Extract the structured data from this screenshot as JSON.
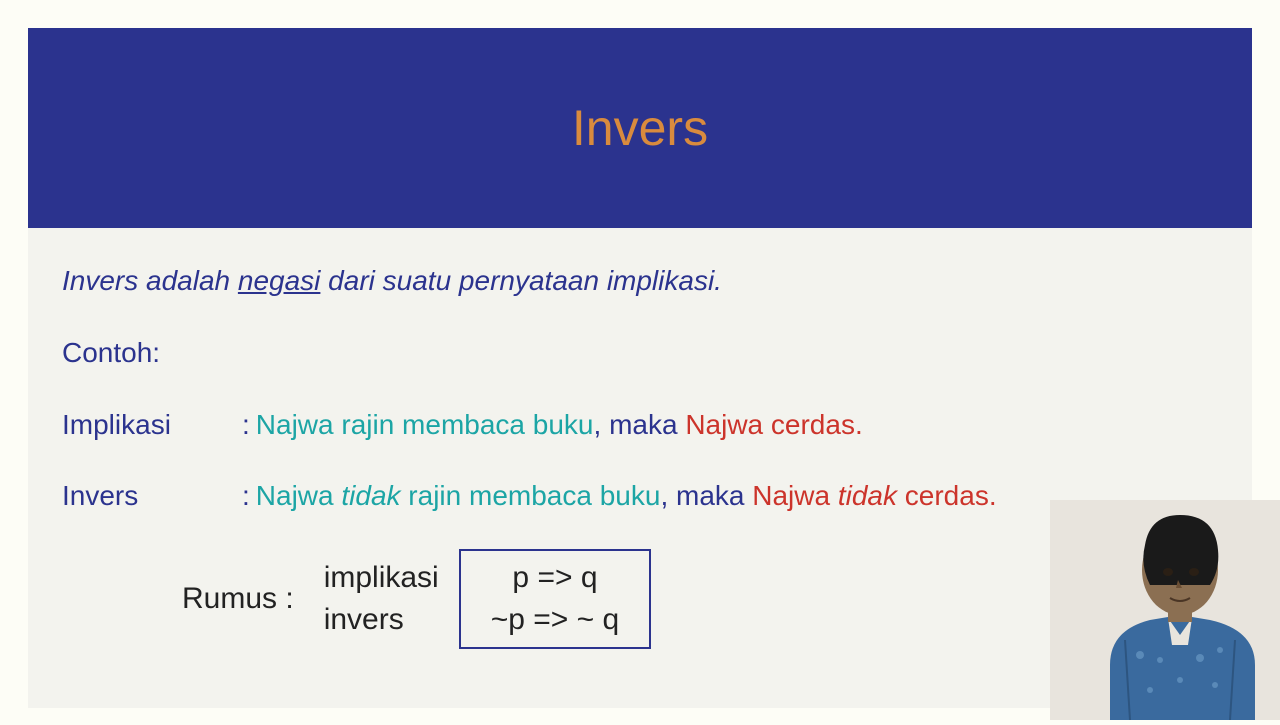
{
  "header": {
    "title": "Invers"
  },
  "definition": {
    "pre": "Invers adalah ",
    "underlined": "negasi",
    "post": " dari suatu pernyataan implikasi."
  },
  "contoh_label": "Contoh:",
  "examples": {
    "implikasi": {
      "label": "Implikasi",
      "p_teal": "Najwa rajin membaca buku",
      "comma": ", ",
      "maka": "maka ",
      "q_red": "Najwa cerdas."
    },
    "invers": {
      "label": "Invers",
      "p_pre": "Najwa ",
      "p_neg": "tidak",
      "p_post": " rajin membaca buku",
      "comma": ", ",
      "maka": "maka ",
      "q_pre": "Najwa ",
      "q_neg": "tidak",
      "q_post": " cerdas."
    }
  },
  "formula": {
    "rumus_label": "Rumus :",
    "row1_label": "implikasi",
    "row2_label": "invers",
    "row1_formula": "p => q",
    "row2_formula": "~p => ~ q"
  }
}
